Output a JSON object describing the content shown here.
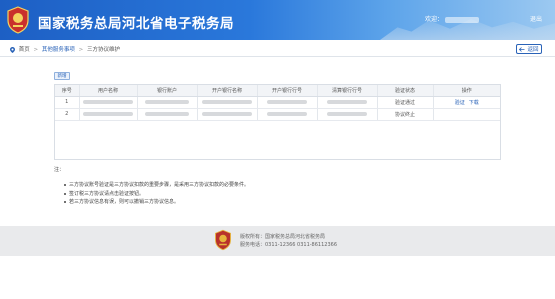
{
  "header": {
    "title": "国家税务总局河北省电子税务局",
    "welcome": "欢迎：",
    "exit_label": "退出",
    "brand_color": "#1d5fc4"
  },
  "breadcrumb": {
    "home": "首页",
    "section": "其他服务事项",
    "current": "三方协议维护",
    "back_label": "返回"
  },
  "toolbar": {
    "new_label": "新增"
  },
  "table": {
    "columns": [
      "序号",
      "用户名称",
      "银行账户",
      "开户银行名称",
      "开户银行行号",
      "清算银行行号",
      "验证状态",
      "操作"
    ],
    "rows": [
      {
        "index": "1",
        "status": "验证通过",
        "actions": [
          "验证",
          "下载"
        ]
      },
      {
        "index": "2",
        "status": "协议终止",
        "actions": []
      }
    ]
  },
  "notes": {
    "title": "注：",
    "items": [
      "三方协议账号验证是三方协议扣款的重要步骤，是采用三方协议扣款的必要条件。",
      "签订税三方协议请点击验证按钮。",
      "若三方协议信息有误，则可以撤销三方协议信息。"
    ]
  },
  "footer": {
    "copyright": "版权所有：国家税务总局河北省税务局",
    "hotline": "服务电话：0311-12366 0311-86112366"
  }
}
